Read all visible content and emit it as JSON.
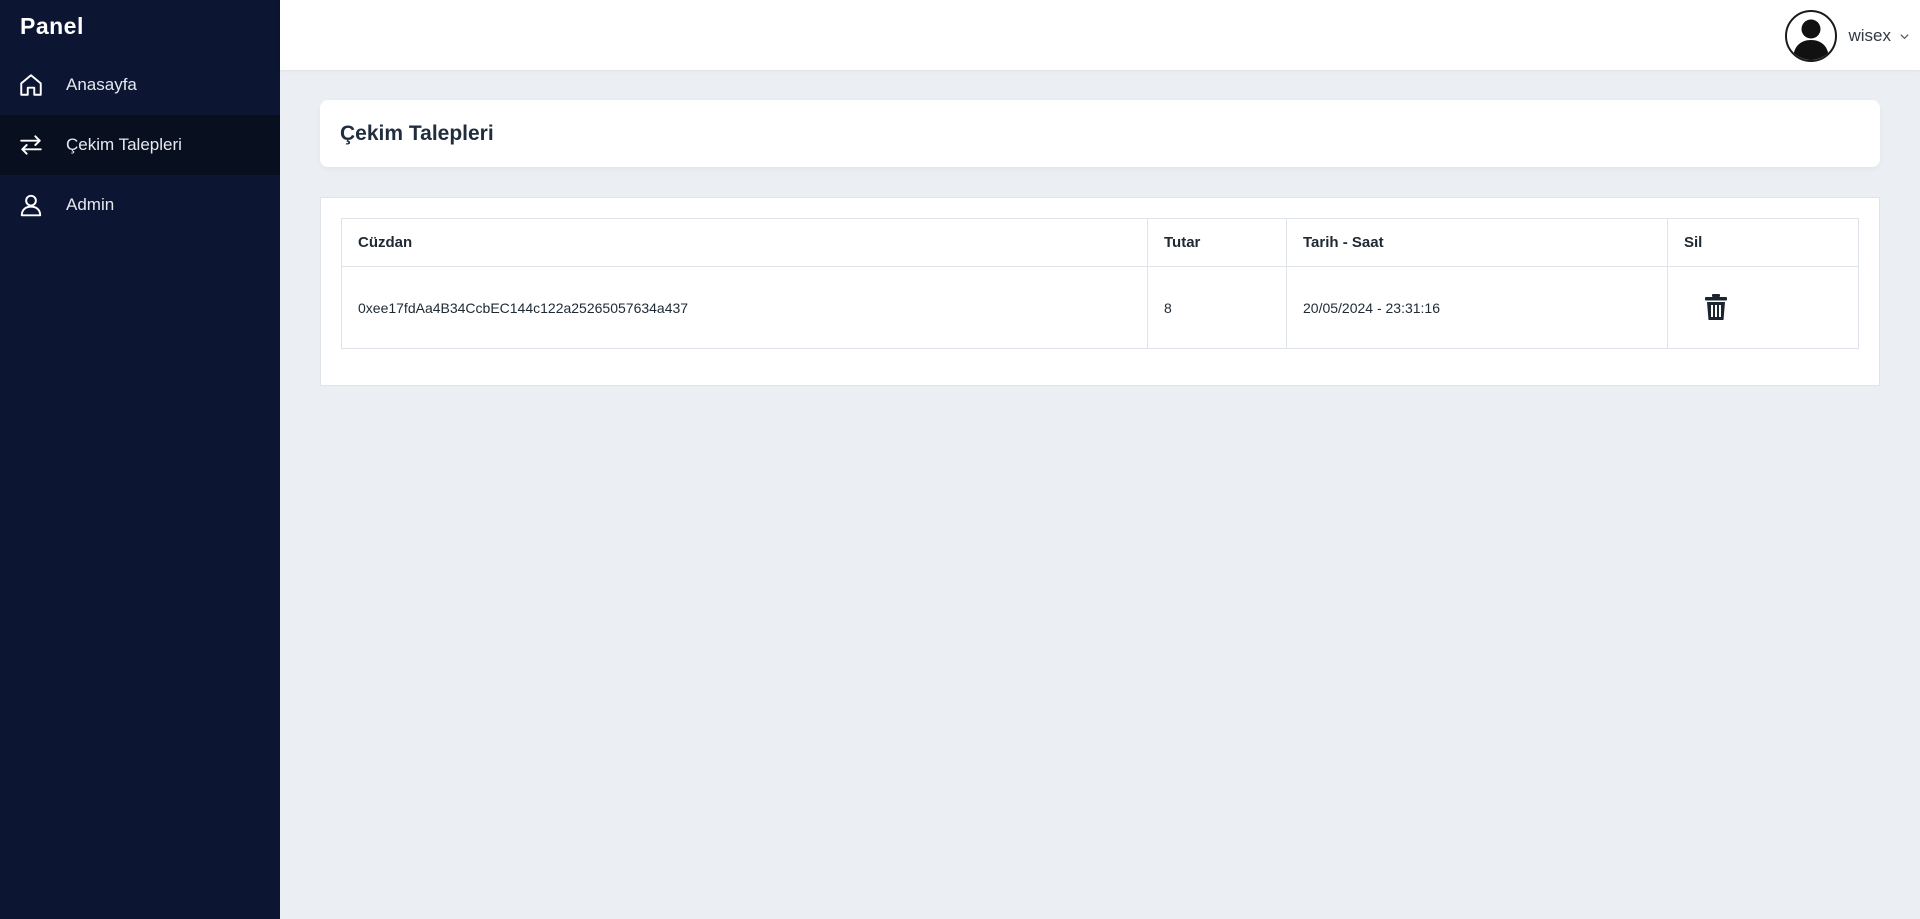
{
  "sidebar": {
    "brand": "Panel",
    "items": [
      {
        "label": "Anasayfa",
        "icon": "home-icon"
      },
      {
        "label": "Çekim Talepleri",
        "icon": "transfer-arrows-icon",
        "active": true
      },
      {
        "label": "Admin",
        "icon": "user-icon"
      }
    ]
  },
  "topbar": {
    "username": "wisex",
    "avatar_icon": "avatar-silhouette-icon",
    "dropdown_icon": "chevron-down-icon"
  },
  "page": {
    "title": "Çekim Talepleri"
  },
  "table": {
    "headers": [
      "Cüzdan",
      "Tutar",
      "Tarih - Saat",
      "Sil"
    ],
    "rows": [
      {
        "wallet": "0xee17fdAa4B34CcbEC144c122a25265057634a437",
        "amount": "8",
        "datetime": "20/05/2024 - 23:31:16",
        "delete_icon": "trash-icon"
      }
    ]
  },
  "colors": {
    "sidebar_bg": "#0c1532",
    "sidebar_active_bg": "#08101f",
    "page_bg": "#ebeef3",
    "card_bg": "#ffffff"
  }
}
